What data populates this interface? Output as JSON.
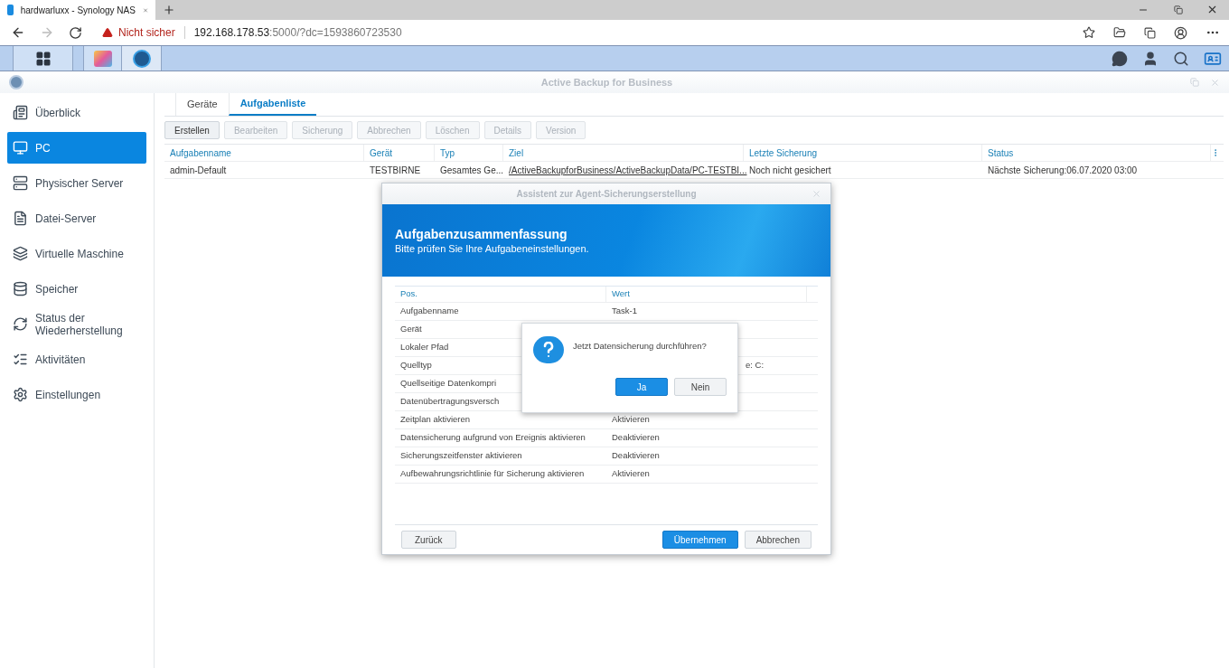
{
  "browser": {
    "tab_title": "hardwarluxx - Synology NAS",
    "security": "Nicht sicher",
    "url_host": "192.168.178.53",
    "url_rest": ":5000/?dc=1593860723530"
  },
  "app": {
    "title": "Active Backup for Business"
  },
  "sidebar": [
    {
      "label": "Überblick",
      "selected": false
    },
    {
      "label": "PC",
      "selected": true
    },
    {
      "label": "Physischer Server",
      "selected": false
    },
    {
      "label": "Datei-Server",
      "selected": false
    },
    {
      "label": "Virtuelle Maschine",
      "selected": false
    },
    {
      "label": "Speicher",
      "selected": false
    },
    {
      "label": "Status der Wiederherstellung",
      "selected": false
    },
    {
      "label": "Aktivitäten",
      "selected": false
    },
    {
      "label": "Einstellungen",
      "selected": false
    }
  ],
  "tabs": [
    {
      "label": "Geräte",
      "selected": false
    },
    {
      "label": "Aufgabenliste",
      "selected": true
    }
  ],
  "toolbar": [
    {
      "label": "Erstellen",
      "disabled": false
    },
    {
      "label": "Bearbeiten",
      "disabled": true
    },
    {
      "label": "Sicherung",
      "disabled": true
    },
    {
      "label": "Abbrechen",
      "disabled": true
    },
    {
      "label": "Löschen",
      "disabled": true
    },
    {
      "label": "Details",
      "disabled": true
    },
    {
      "label": "Version",
      "disabled": true
    }
  ],
  "table": {
    "columns": [
      "Aufgabenname",
      "Gerät",
      "Typ",
      "Ziel",
      "Letzte Sicherung",
      "Status"
    ],
    "rows": [
      {
        "cells": [
          "admin-Default",
          "TESTBIRNE",
          "Gesamtes Ge...",
          "/ActiveBackupforBusiness/ActiveBackupData/PC-TESTBI...",
          "Noch nicht gesichert",
          "Nächste Sicherung:06.07.2020 03:00"
        ]
      }
    ]
  },
  "wizard": {
    "title": "Assistent zur Agent-Sicherungserstellung",
    "heading": "Aufgabenzusammenfassung",
    "subheading": "Bitte prüfen Sie Ihre Aufgabeneinstellungen.",
    "columns": [
      "Pos.",
      "Wert"
    ],
    "rows": [
      {
        "label": "Aufgabenname",
        "value": "Task-1"
      },
      {
        "label": "Gerät"
      },
      {
        "label": "Lokaler Pfad"
      },
      {
        "label": "Quelltyp",
        "value": "e: C:"
      },
      {
        "label": "Quellseitige Datenkompri"
      },
      {
        "label": "Datenübertragungsversch"
      },
      {
        "label": "Zeitplan aktivieren",
        "value": "Aktivieren"
      },
      {
        "label": "Datensicherung aufgrund von Ereignis aktivieren",
        "value": "Deaktivieren"
      },
      {
        "label": "Sicherungszeitfenster aktivieren",
        "value": "Deaktivieren"
      },
      {
        "label": "Aufbewahrungsrichtlinie für Sicherung aktivieren",
        "value": "Aktivieren"
      }
    ],
    "buttons": [
      {
        "label": "Zurück",
        "primary": false
      },
      {
        "label": "Übernehmen",
        "primary": true
      },
      {
        "label": "Abbrechen",
        "primary": false
      }
    ]
  },
  "confirm": {
    "message": "Jetzt Datensicherung durchführen?",
    "buttons": [
      {
        "label": "Ja",
        "primary": true
      },
      {
        "label": "Nein",
        "primary": false
      }
    ]
  }
}
